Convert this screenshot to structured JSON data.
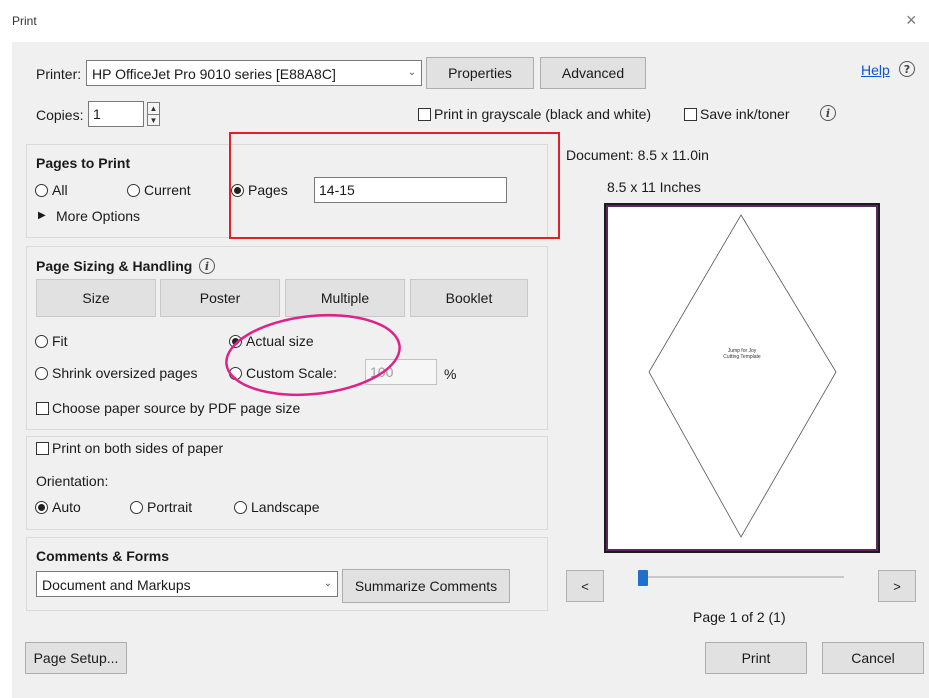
{
  "window": {
    "title": "Print",
    "close_glyph": "×"
  },
  "printer": {
    "label": "Printer:",
    "selected": "HP OfficeJet Pro 9010 series [E88A8C]",
    "properties_label": "Properties",
    "advanced_label": "Advanced",
    "help_label": "Help"
  },
  "copies": {
    "label": "Copies:",
    "value": "1",
    "grayscale_label": "Print in grayscale (black and white)",
    "save_ink_label": "Save ink/toner"
  },
  "pages_to_print": {
    "title": "Pages to Print",
    "all_label": "All",
    "current_label": "Current",
    "pages_label": "Pages",
    "pages_value": "14-15",
    "more_options_label": "More Options"
  },
  "sizing": {
    "title": "Page Sizing & Handling",
    "tabs": [
      "Size",
      "Poster",
      "Multiple",
      "Booklet"
    ],
    "fit_label": "Fit",
    "actual_size_label": "Actual size",
    "shrink_label": "Shrink oversized pages",
    "custom_scale_label": "Custom Scale:",
    "custom_scale_value": "100",
    "percent": "%",
    "paper_source_label": "Choose paper source by PDF page size"
  },
  "duplex": {
    "both_sides_label": "Print on both sides of paper",
    "orientation_label": "Orientation:",
    "auto_label": "Auto",
    "portrait_label": "Portrait",
    "landscape_label": "Landscape"
  },
  "comments": {
    "title": "Comments & Forms",
    "selected": "Document and Markups",
    "summarize_label": "Summarize Comments"
  },
  "preview": {
    "document_size": "Document: 8.5 x 11.0in",
    "paper_size": "8.5 x 11 Inches",
    "page_text_line1": "Jump for Joy",
    "page_text_line2": "Cutting Template",
    "prev_glyph": "<",
    "next_glyph": ">",
    "page_indicator": "Page 1 of 2 (1)",
    "slider_position": 0.0
  },
  "footer": {
    "page_setup_label": "Page Setup...",
    "print_label": "Print",
    "cancel_label": "Cancel"
  },
  "colors": {
    "annotation_rect": "#e0202a",
    "annotation_ellipse": "#e0218a",
    "slider_thumb": "#1e6fd0"
  }
}
